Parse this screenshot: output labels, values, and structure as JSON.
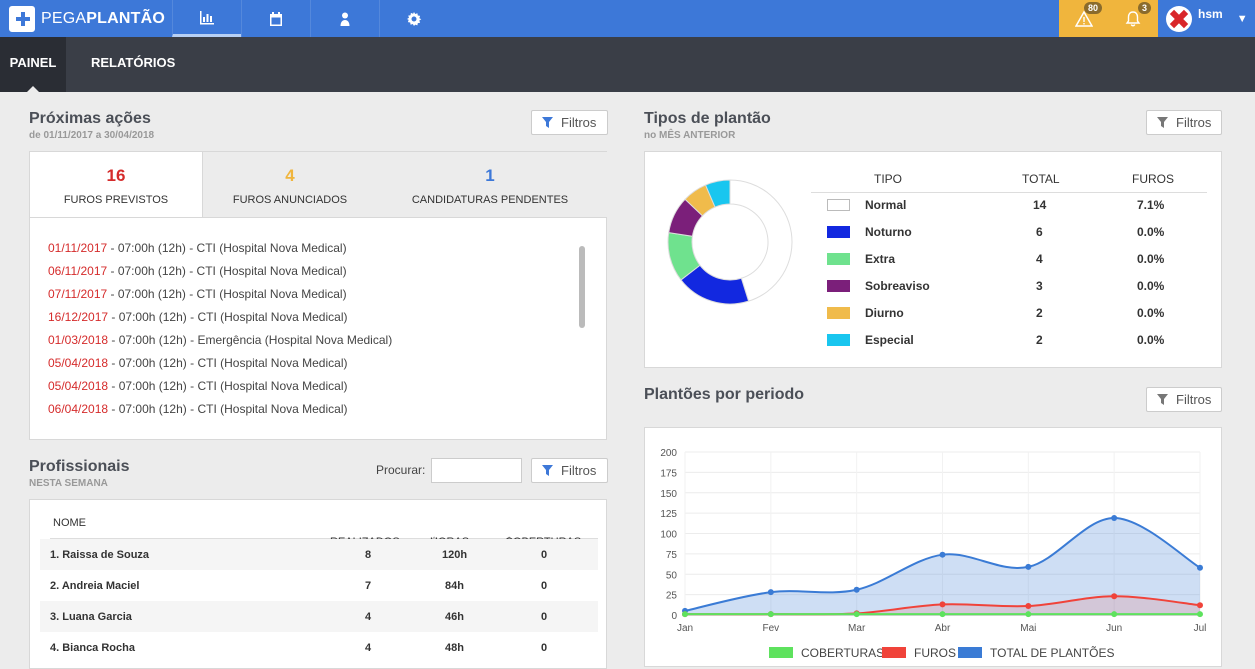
{
  "app": {
    "logo_light": "PEGA",
    "logo_bold": "PLANTÃO"
  },
  "nav_icons": [
    "chart-bar-icon",
    "calendar-icon",
    "person-icon",
    "gear-icon"
  ],
  "alerts": [
    {
      "icon": "warning-icon",
      "count": "80"
    },
    {
      "icon": "bell-icon",
      "count": "3"
    }
  ],
  "user": {
    "name": "hsm"
  },
  "subnav": {
    "painel": "PAINEL",
    "relatorios": "RELATÓRIOS"
  },
  "proximas": {
    "title": "Próximas ações",
    "subtitle": "de 01/11/2017 a 30/04/2018",
    "filter_label": "Filtros",
    "tabs": [
      {
        "num": "16",
        "label": "FUROS PREVISTOS",
        "color": "#d52b2b"
      },
      {
        "num": "4",
        "label": "FUROS ANUNCIADOS",
        "color": "#f0b53d"
      },
      {
        "num": "1",
        "label": "CANDIDATURAS PENDENTES",
        "color": "#3d78d8"
      }
    ],
    "items": [
      {
        "date": "01/11/2017",
        "rest": " - 07:00h (12h) - CTI (Hospital Nova Medical)"
      },
      {
        "date": "06/11/2017",
        "rest": " - 07:00h (12h) - CTI (Hospital Nova Medical)"
      },
      {
        "date": "07/11/2017",
        "rest": " - 07:00h (12h) - CTI (Hospital Nova Medical)"
      },
      {
        "date": "16/12/2017",
        "rest": " - 07:00h (12h) - CTI (Hospital Nova Medical)"
      },
      {
        "date": "01/03/2018",
        "rest": " - 07:00h (12h) - Emergência (Hospital Nova Medical)"
      },
      {
        "date": "05/04/2018",
        "rest": " - 07:00h (12h) - CTI (Hospital Nova Medical)"
      },
      {
        "date": "05/04/2018",
        "rest": " - 07:00h (12h) - CTI (Hospital Nova Medical)"
      },
      {
        "date": "06/04/2018",
        "rest": " - 07:00h (12h) - CTI (Hospital Nova Medical)"
      }
    ]
  },
  "profissionais": {
    "title": "Profissionais",
    "subtitle": "NESTA SEMANA",
    "search_label": "Procurar:",
    "search_value": "",
    "filter_label": "Filtros",
    "columns": [
      "NOME",
      "REALIZADOS",
      "HORAS",
      "COBERTURAS"
    ],
    "rows": [
      {
        "name": "1. Raissa de Souza",
        "realizados": "8",
        "horas": "120h",
        "coberturas": "0"
      },
      {
        "name": "2. Andreia Maciel",
        "realizados": "7",
        "horas": "84h",
        "coberturas": "0"
      },
      {
        "name": "3. Luana Garcia",
        "realizados": "4",
        "horas": "46h",
        "coberturas": "0"
      },
      {
        "name": "4. Bianca Rocha",
        "realizados": "4",
        "horas": "48h",
        "coberturas": "0"
      }
    ]
  },
  "tipos": {
    "title": "Tipos de plantão",
    "subtitle": "no MÊS ANTERIOR",
    "filter_label": "Filtros",
    "columns": [
      "TIPO",
      "TOTAL",
      "FUROS"
    ],
    "rows": [
      {
        "tipo": "Normal",
        "total": "14",
        "furos": "7.1%",
        "color": "#ffffff"
      },
      {
        "tipo": "Noturno",
        "total": "6",
        "furos": "0.0%",
        "color": "#1228e0"
      },
      {
        "tipo": "Extra",
        "total": "4",
        "furos": "0.0%",
        "color": "#6fe28e"
      },
      {
        "tipo": "Sobreaviso",
        "total": "3",
        "furos": "0.0%",
        "color": "#7b1f7a"
      },
      {
        "tipo": "Diurno",
        "total": "2",
        "furos": "0.0%",
        "color": "#f0bb4b"
      },
      {
        "tipo": "Especial",
        "total": "2",
        "furos": "0.0%",
        "color": "#19c6ef"
      }
    ]
  },
  "periodo": {
    "title": "Plantões por periodo",
    "filter_label": "Filtros"
  },
  "chart_data": [
    {
      "type": "pie",
      "categories": [
        "Normal",
        "Noturno",
        "Extra",
        "Sobreaviso",
        "Diurno",
        "Especial"
      ],
      "values": [
        14,
        6,
        4,
        3,
        2,
        2
      ],
      "colors": [
        "#ffffff",
        "#1228e0",
        "#6fe28e",
        "#7b1f7a",
        "#f0bb4b",
        "#19c6ef"
      ],
      "donut": true
    },
    {
      "type": "area",
      "categories": [
        "Jan",
        "Fev",
        "Mar",
        "Abr",
        "Mai",
        "Jun",
        "Jul"
      ],
      "ylim": [
        0,
        200
      ],
      "yticks": [
        0,
        25,
        50,
        75,
        100,
        125,
        150,
        175,
        200
      ],
      "grid": true,
      "legend": "bottom",
      "series": [
        {
          "name": "COBERTURAS",
          "values": [
            1,
            1,
            1,
            1,
            1,
            1,
            1
          ],
          "color": "#5ee25e"
        },
        {
          "name": "FUROS",
          "values": [
            1,
            1,
            2,
            13,
            11,
            23,
            12
          ],
          "color": "#f0433a"
        },
        {
          "name": "TOTAL DE PLANTÕES",
          "values": [
            5,
            28,
            31,
            74,
            59,
            119,
            58
          ],
          "color": "#3a7bd5"
        }
      ]
    }
  ]
}
